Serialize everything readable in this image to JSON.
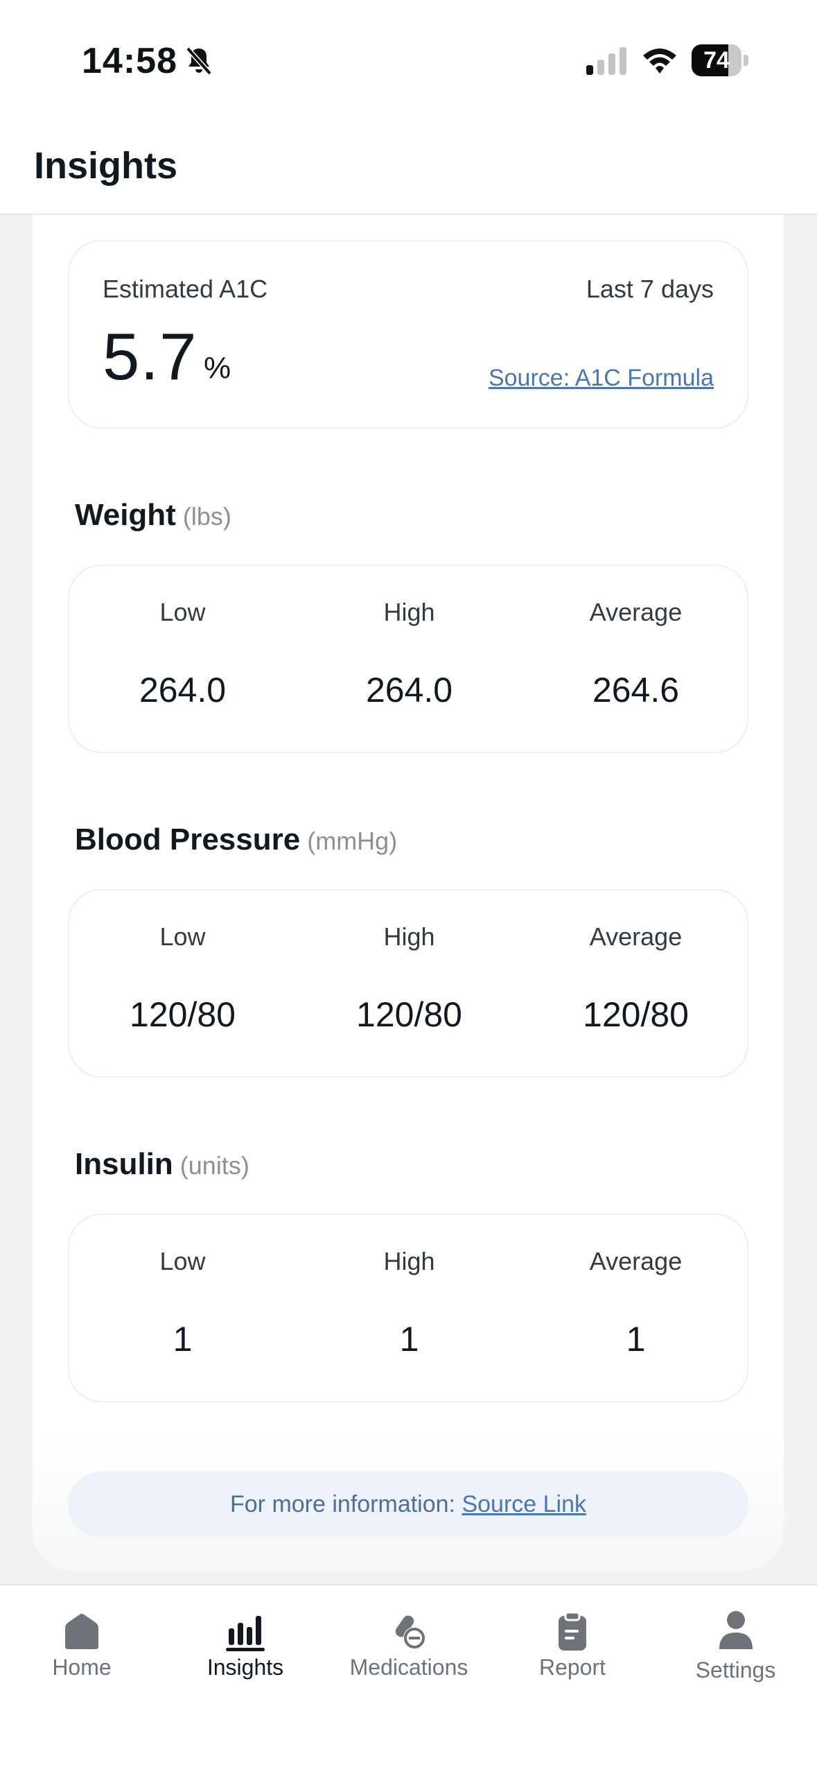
{
  "status_bar": {
    "time": "14:58",
    "battery": "74",
    "battery_level": 0.74
  },
  "header": {
    "title": "Insights"
  },
  "a1c": {
    "label": "Estimated A1C",
    "period": "Last 7 days",
    "value": "5.7",
    "unit": "%",
    "source_link": "Source: A1C Formula"
  },
  "sections": [
    {
      "title": "Weight",
      "unit": "(lbs)",
      "stats": [
        {
          "label": "Low",
          "value": "264.0"
        },
        {
          "label": "High",
          "value": "264.0"
        },
        {
          "label": "Average",
          "value": "264.6"
        }
      ]
    },
    {
      "title": "Blood Pressure",
      "unit": "(mmHg)",
      "stats": [
        {
          "label": "Low",
          "value": "120/80"
        },
        {
          "label": "High",
          "value": "120/80"
        },
        {
          "label": "Average",
          "value": "120/80"
        }
      ]
    },
    {
      "title": "Insulin",
      "unit": "(units)",
      "stats": [
        {
          "label": "Low",
          "value": "1"
        },
        {
          "label": "High",
          "value": "1"
        },
        {
          "label": "Average",
          "value": "1"
        }
      ]
    }
  ],
  "info": {
    "prefix": "For more information:",
    "link": "Source Link"
  },
  "tabs": [
    {
      "label": "Home",
      "icon": "home-icon"
    },
    {
      "label": "Insights",
      "icon": "bar-chart-icon",
      "active": true
    },
    {
      "label": "Medications",
      "icon": "pills-icon"
    },
    {
      "label": "Report",
      "icon": "clipboard-icon"
    },
    {
      "label": "Settings",
      "icon": "person-icon"
    }
  ],
  "colors": {
    "accent_link": "#4a76b6",
    "text": "#111820",
    "muted": "#6d7378",
    "info_bg": "#eef2fa"
  }
}
